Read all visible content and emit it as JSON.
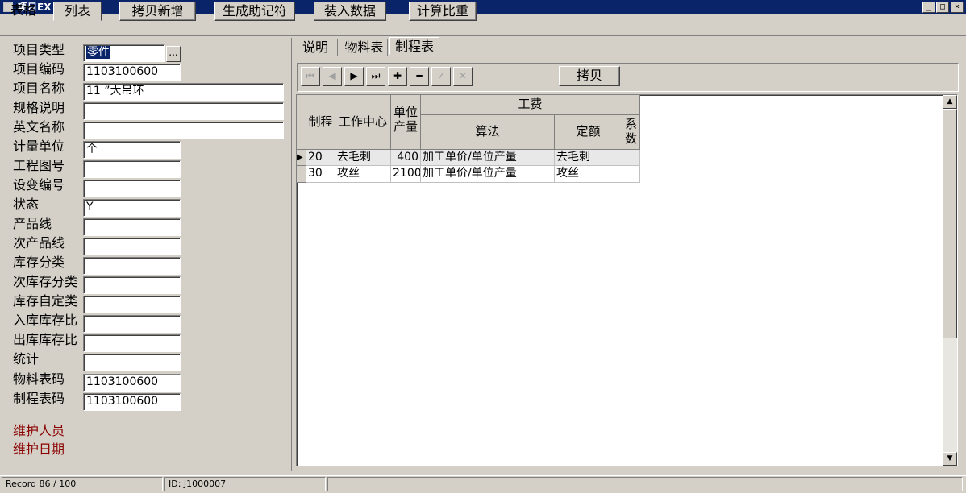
{
  "window": {
    "title": "项目EX",
    "min_symbol": "_",
    "max_symbol": "□",
    "close_symbol": "×"
  },
  "toolbar": {
    "tabs": [
      "表格",
      "列表"
    ],
    "selected_tab": "列表",
    "buttons": [
      "拷贝新增",
      "生成助记符",
      "装入数据",
      "计算比重"
    ]
  },
  "form": {
    "labels": [
      "项目类型",
      "项目编码",
      "项目名称",
      "规格说明",
      "英文名称",
      "计量单位",
      "工程图号",
      "设变编号",
      "状态",
      "产品线",
      "次产品线",
      "库存分类",
      "次库存分类",
      "库存自定类",
      "入库库存比",
      "出库库存比",
      "统计",
      "物料表码",
      "制程表码"
    ],
    "values": {
      "item_type": "零件",
      "item_code": "1103100600",
      "item_name": "11 ”大吊环",
      "spec": "",
      "english_name": "",
      "unit": "个",
      "drawing_no": "",
      "change_no": "",
      "status": "Y",
      "product_line": "",
      "sub_product_line": "",
      "stock_class": "",
      "sub_stock_class": "",
      "stock_custom_class": "",
      "in_stock_ratio": "",
      "out_stock_ratio": "",
      "statistics": "",
      "bom_code": "1103100600",
      "routing_code": "1103100600"
    },
    "ellipsis": "...",
    "maintainer_label": "维护人员",
    "maintain_date_label": "维护日期"
  },
  "right_tabs": [
    "说明",
    "物料表",
    "制程表"
  ],
  "right_selected_tab": "制程表",
  "nav": {
    "first": "⏮",
    "prev": "◀",
    "next": "▶",
    "last": "⏭",
    "add": "✚",
    "delete": "━",
    "post": "✓",
    "cancel": "✕",
    "copy_label": "拷贝"
  },
  "grid": {
    "headers": {
      "process": "制程",
      "work_center": "工作中心",
      "unit_output": "单位产量",
      "labor_cost": "工费",
      "method": "算法",
      "quota": "定额",
      "coefficient": "系数"
    },
    "rows": [
      {
        "process": "20",
        "work_center": "去毛刺",
        "unit_output": "400",
        "method": "加工单价/单位产量",
        "quota": "去毛刺",
        "coefficient": ""
      },
      {
        "process": "30",
        "work_center": "攻丝",
        "unit_output": "2100",
        "method": "加工单价/单位产量",
        "quota": "攻丝",
        "coefficient": ""
      }
    ],
    "current_row_marker": "▶"
  },
  "scroll": {
    "up": "▲",
    "down": "▼"
  },
  "status": {
    "record": "Record 86 / 100",
    "id": "ID: J1000007"
  }
}
